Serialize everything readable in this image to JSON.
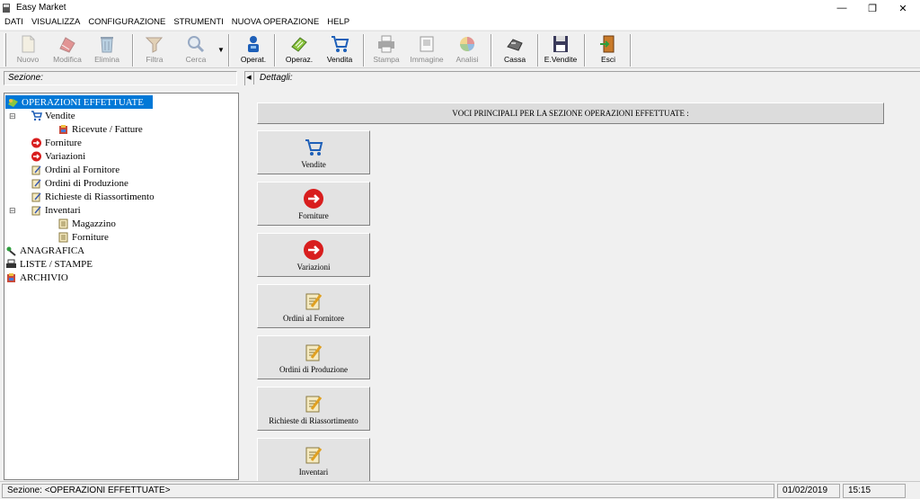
{
  "window": {
    "title": "Easy Market",
    "minimize": "—",
    "restore": "❐",
    "close": "✕"
  },
  "menu": [
    "DATI",
    "VISUALIZZA",
    "CONFIGURAZIONE",
    "STRUMENTI",
    "NUOVA OPERAZIONE",
    "HELP"
  ],
  "toolbar": {
    "nuovo": "Nuovo",
    "modifica": "Modifica",
    "elimina": "Elimina",
    "filtra": "Filtra",
    "cerca": "Cerca",
    "operat": "Operat.",
    "operaz": "Operaz.",
    "vendita": "Vendita",
    "stampa": "Stampa",
    "immagine": "Immagine",
    "analisi": "Analisi",
    "cassa": "Cassa",
    "evendite": "E.Vendite",
    "esci": "Esci"
  },
  "panels": {
    "sezione": "Sezione:",
    "dettagli": "Dettagli:"
  },
  "tree": {
    "root": "OPERAZIONI EFFETTUATE",
    "vendite": "Vendite",
    "ricevute": "Ricevute / Fatture",
    "forniture": "Forniture",
    "variazioni": "Variazioni",
    "ordini_fornitore": "Ordini al Fornitore",
    "ordini_produzione": "Ordini di Produzione",
    "richieste": "Richieste di Riassortimento",
    "inventari": "Inventari",
    "magazzino": "Magazzino",
    "inv_forniture": "Forniture",
    "anagrafica": "ANAGRAFICA",
    "liste": "LISTE / STAMPE",
    "archivio": "ARCHIVIO"
  },
  "main": {
    "banner": "VOCI PRINCIPALI PER LA SEZIONE OPERAZIONI EFFETTUATE :",
    "buttons": [
      "Vendite",
      "Forniture",
      "Variazioni",
      "Ordini al Fornitore",
      "Ordini di Produzione",
      "Richieste di Riassortimento",
      "Inventari"
    ]
  },
  "status": {
    "section": "Sezione:  <OPERAZIONI EFFETTUATE>",
    "date": "01/02/2019",
    "time": "15:15"
  },
  "icons": {
    "nuovo": "new-document-icon",
    "modifica": "edit-icon",
    "elimina": "trash-icon",
    "filtra": "filter-icon",
    "cerca": "search-icon",
    "operat": "operator-icon",
    "operaz": "operation-icon",
    "vendita": "cart-icon",
    "stampa": "printer-icon",
    "immagine": "image-icon",
    "analisi": "pie-chart-icon",
    "cassa": "cash-register-icon",
    "evendite": "floppy-disk-icon",
    "esci": "exit-door-icon"
  },
  "colors": {
    "selection": "#0078d7",
    "red_arrow": "#d81e1e",
    "cart_blue": "#1d5fb8"
  }
}
